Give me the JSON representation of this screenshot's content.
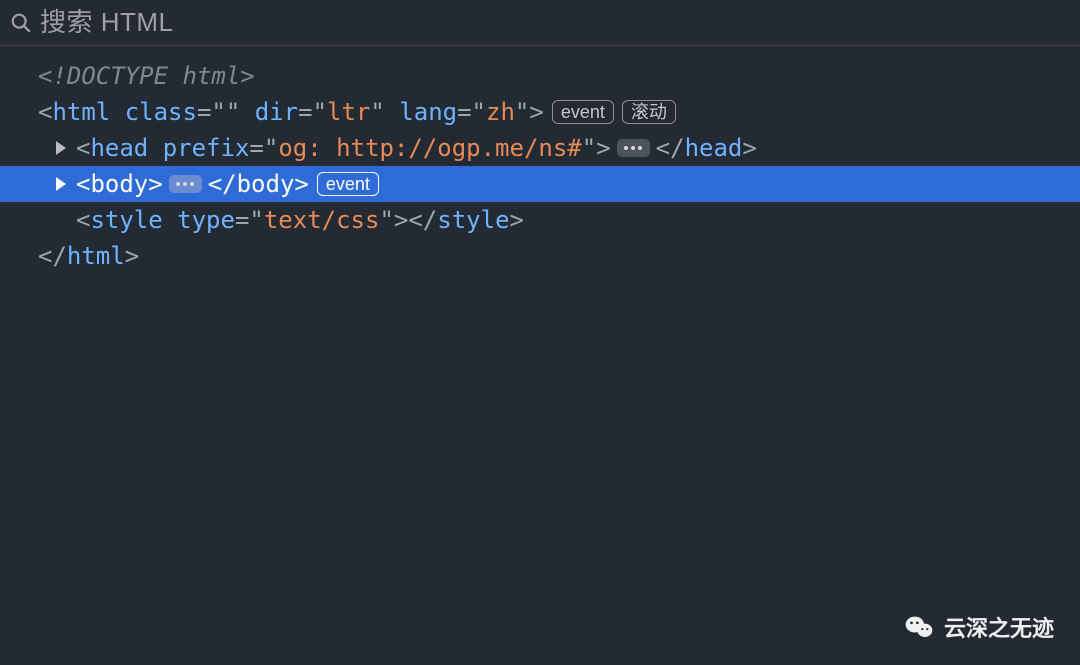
{
  "search": {
    "placeholder": "搜索 HTML"
  },
  "tree": {
    "doctype": "<!DOCTYPE html>",
    "html_open": {
      "tag": "html",
      "attrs": [
        {
          "name": "class",
          "value": ""
        },
        {
          "name": "dir",
          "value": "ltr"
        },
        {
          "name": "lang",
          "value": "zh"
        }
      ],
      "badges": [
        "event",
        "滚动"
      ]
    },
    "head": {
      "tag": "head",
      "attr_name": "prefix",
      "attr_value": "og: http://ogp.me/ns#",
      "close_tag": "head"
    },
    "body": {
      "tag": "body",
      "close_tag": "body",
      "badges": [
        "event"
      ]
    },
    "style": {
      "tag": "style",
      "attr_name": "type",
      "attr_value": "text/css",
      "close_tag": "style"
    },
    "html_close": {
      "tag": "html"
    }
  },
  "watermark": "云深之无迹"
}
